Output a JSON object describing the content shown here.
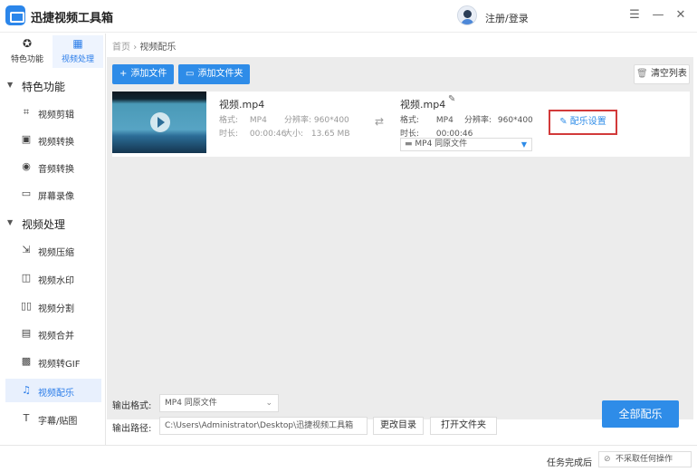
{
  "app": {
    "title": "迅捷视频工具箱",
    "login": "注册/登录"
  },
  "sidebar": {
    "tabs": [
      {
        "icon": "star-circle-icon",
        "label": "特色功能"
      },
      {
        "icon": "film-icon",
        "label": "视频处理"
      }
    ],
    "groups": [
      {
        "label": "特色功能",
        "items": [
          "视频剪辑",
          "视频转换",
          "音频转换",
          "屏幕录像"
        ]
      },
      {
        "label": "视频处理",
        "items": [
          "视频压缩",
          "视频水印",
          "视频分割",
          "视频合并",
          "视频转GIF",
          "视频配乐",
          "字幕/贴图"
        ]
      }
    ],
    "active_item": "视频配乐"
  },
  "breadcrumb": {
    "home": "首页",
    "sep": "›",
    "current": "视频配乐"
  },
  "toolbar": {
    "add_file": "添加文件",
    "add_folder": "添加文件夹",
    "clear_list": "清空列表"
  },
  "file": {
    "source": {
      "name": "视频.mp4",
      "format_label": "格式:",
      "format": "MP4",
      "resolution_label": "分辨率:",
      "resolution": "960*400",
      "duration_label": "时长:",
      "duration": "00:00:46",
      "size_label": "大小:",
      "size": "13.65 MB"
    },
    "output": {
      "name": "视频.mp4",
      "format_label": "格式:",
      "format": "MP4",
      "resolution_label": "分辨率:",
      "resolution": "960*400",
      "duration_label": "时长:",
      "duration": "00:00:46",
      "format_select": "MP4  同原文件"
    },
    "music_settings": "配乐设置"
  },
  "config": {
    "format_label": "输出格式:",
    "format_value": "MP4  同原文件",
    "path_label": "输出路径:",
    "path_value": "C:\\Users\\Administrator\\Desktop\\迅捷视频工具箱",
    "change_dir": "更改目录",
    "open_folder": "打开文件夹",
    "all_music": "全部配乐"
  },
  "status": {
    "label": "任务完成后",
    "option": "不采取任何操作"
  },
  "colors": {
    "accent": "#2e8ce8",
    "highlight_border": "#d23a3a"
  }
}
